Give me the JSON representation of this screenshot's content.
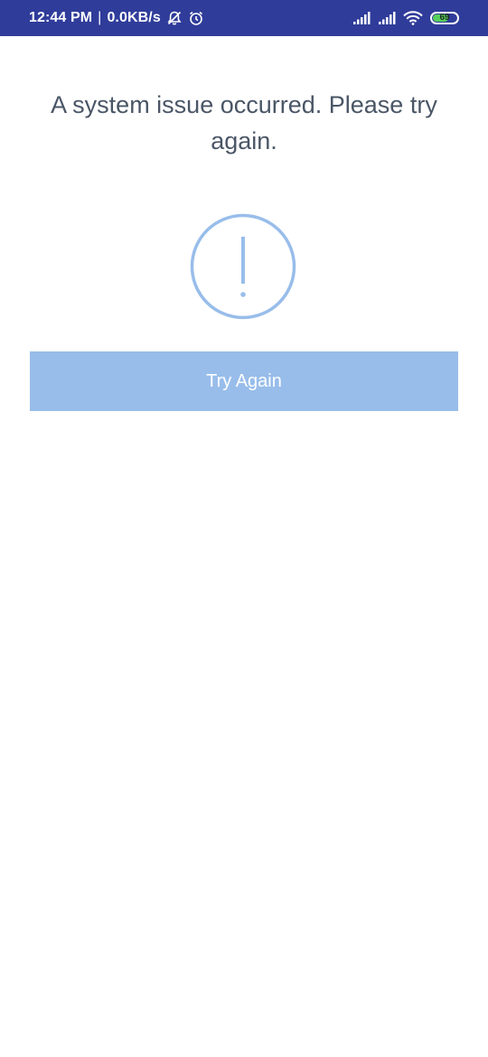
{
  "status_bar": {
    "time": "12:44 PM",
    "separator": "|",
    "network_speed": "0.0KB/s",
    "icons": [
      "bell-muted-icon",
      "alarm-icon",
      "signal-icon",
      "signal-icon",
      "wifi-icon",
      "battery-icon"
    ],
    "battery_level": "69"
  },
  "error": {
    "message": "A system issue occurred. Please try again.",
    "icon": "exclamation-circle-icon",
    "button_label": "Try Again"
  },
  "colors": {
    "status_bar_bg": "#2f3c9a",
    "accent": "#98bdea",
    "text": "#4a5666",
    "battery_fill": "#57d05b"
  }
}
